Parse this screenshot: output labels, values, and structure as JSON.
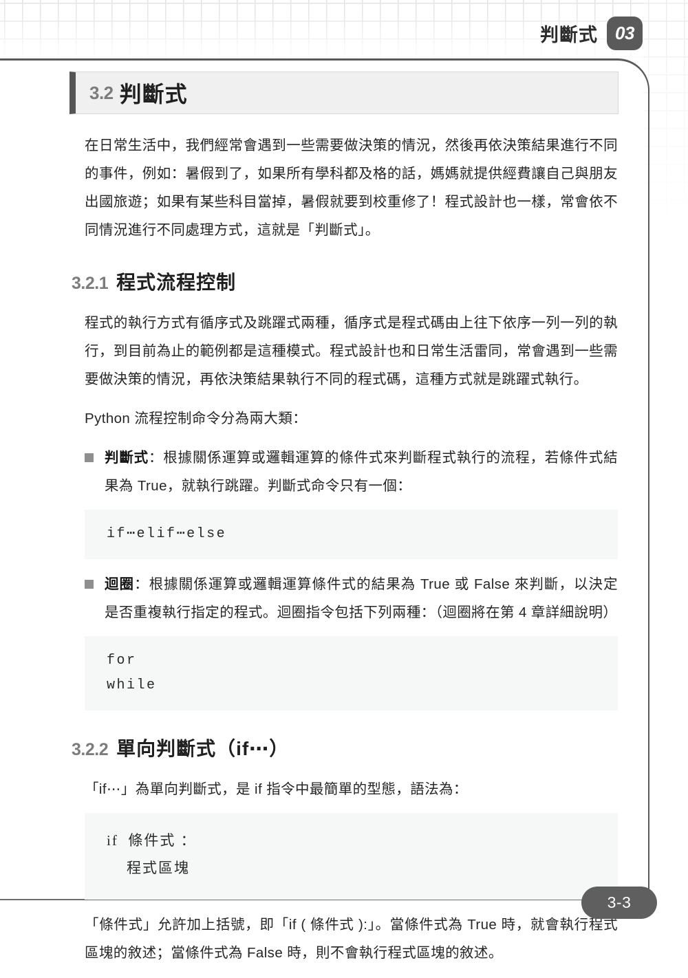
{
  "page": {
    "running_head_title": "判斷式",
    "chapter_badge": "03",
    "page_number": "3-3"
  },
  "section": {
    "number": "3.2",
    "title": "判斷式",
    "intro_paragraph": "在日常生活中，我們經常會遇到一些需要做決策的情況，然後再依決策結果進行不同的事件，例如：暑假到了，如果所有學科都及格的話，媽媽就提供經費讓自己與朋友出國旅遊；如果有某些科目當掉，暑假就要到校重修了！程式設計也一樣，常會依不同情況進行不同處理方式，這就是「判斷式」。"
  },
  "subsection_1": {
    "number": "3.2.1",
    "title": "程式流程控制",
    "paragraph_1": "程式的執行方式有循序式及跳躍式兩種，循序式是程式碼由上往下依序一列一列的執行，到目前為止的範例都是這種模式。程式設計也和日常生活雷同，常會遇到一些需要做決策的情況，再依決策結果執行不同的程式碼，這種方式就是跳躍式執行。",
    "paragraph_2": "Python 流程控制命令分為兩大類：",
    "bullets": [
      {
        "term": "判斷式",
        "text": "：根據關係運算或邏輯運算的條件式來判斷程式執行的流程，若條件式結果為 True，就執行跳躍。判斷式命令只有一個："
      },
      {
        "term": "迴圈",
        "text": "：根據關係運算或邏輯運算條件式的結果為 True 或 False 來判斷，以決定是否重複執行指定的程式。迴圈指令包括下列兩種：（迴圈將在第 4 章詳細說明）"
      }
    ],
    "code_1": "if⋯elif⋯else",
    "code_2_line_1": "for",
    "code_2_line_2": "while"
  },
  "subsection_2": {
    "number": "3.2.2",
    "title": "單向判斷式（if⋯）",
    "paragraph_1": "「if⋯」為單向判斷式，是 if 指令中最簡單的型態，語法為：",
    "code_line_1": "if  條件式 ：",
    "code_line_2": "    程式區塊",
    "paragraph_2": "「條件式」允許加上括號，即「if ( 條件式 ):」。當條件式為 True 時，就會執行程式區塊的敘述；當條件式為 False 時，則不會執行程式區塊的敘述。"
  },
  "colors": {
    "frame": "#595959",
    "badge_bg": "#5a5a5a",
    "pill_bg": "#5f5f5f",
    "section_box_bg": "#f0f0f0",
    "section_bar": "#555555",
    "code_bg": "#f6f7f7",
    "number_gray": "#7c7c7c",
    "bullet_gray": "#8f8f8f"
  }
}
